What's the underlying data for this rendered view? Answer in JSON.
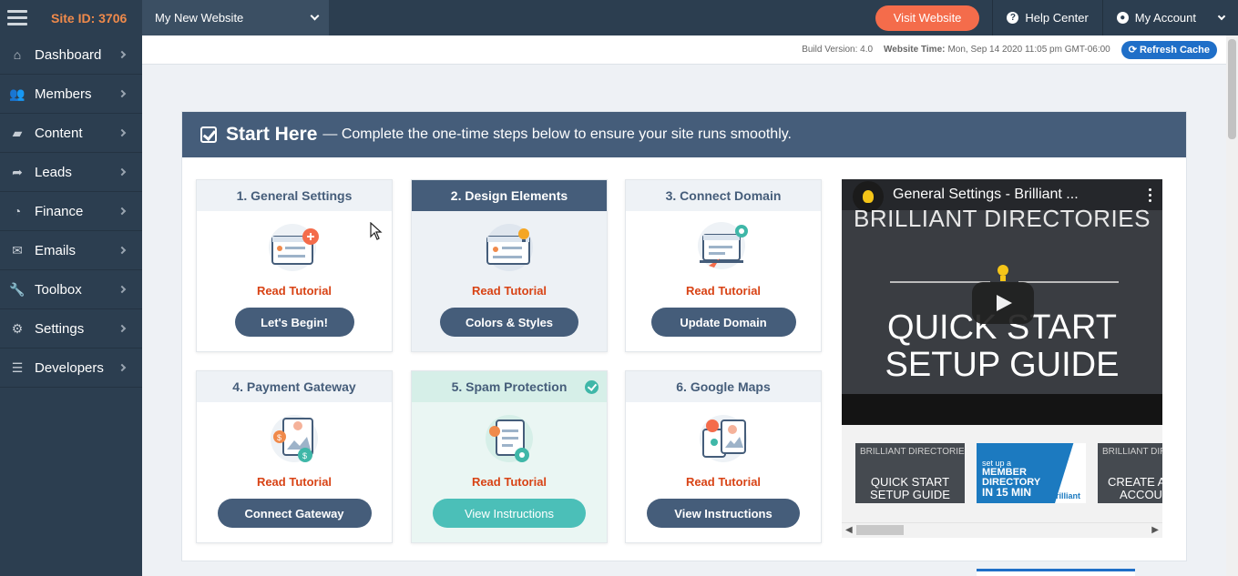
{
  "topbar": {
    "site_id": "Site ID: 3706",
    "site_select": "My New Website",
    "visit_button": "Visit Website",
    "help_center": "Help Center",
    "my_account": "My Account"
  },
  "sidebar": {
    "items": [
      {
        "label": "Dashboard",
        "icon": "home-icon",
        "glyph": "⌂"
      },
      {
        "label": "Members",
        "icon": "users-icon",
        "glyph": "👥"
      },
      {
        "label": "Content",
        "icon": "folder-icon",
        "glyph": "▰"
      },
      {
        "label": "Leads",
        "icon": "share-icon",
        "glyph": "➦"
      },
      {
        "label": "Finance",
        "icon": "pie-chart-icon",
        "glyph": "◔"
      },
      {
        "label": "Emails",
        "icon": "inbox-icon",
        "glyph": "✉"
      },
      {
        "label": "Toolbox",
        "icon": "wrench-icon",
        "glyph": "🔧"
      },
      {
        "label": "Settings",
        "icon": "gear-icon",
        "glyph": "⚙"
      },
      {
        "label": "Developers",
        "icon": "sliders-icon",
        "glyph": "☰"
      }
    ]
  },
  "subheader": {
    "build_label": "Build Version: 4.0",
    "time_key": "Website Time:",
    "time_value": "Mon, Sep 14 2020 11:05 pm GMT-06:00",
    "refresh_button": "Refresh Cache"
  },
  "start_here": {
    "title": "Start Here",
    "subtitle": "— Complete the one-time steps below to ensure your site runs smoothly."
  },
  "cards": [
    {
      "title": "1. General Settings",
      "link": "Read Tutorial",
      "button": "Let's Begin!"
    },
    {
      "title": "2. Design Elements",
      "link": "Read Tutorial",
      "button": "Colors & Styles"
    },
    {
      "title": "3. Connect Domain",
      "link": "Read Tutorial",
      "button": "Update Domain"
    },
    {
      "title": "4. Payment Gateway",
      "link": "Read Tutorial",
      "button": "Connect Gateway"
    },
    {
      "title": "5. Spam Protection",
      "link": "Read Tutorial",
      "button": "View Instructions"
    },
    {
      "title": "6. Google Maps",
      "link": "Read Tutorial",
      "button": "View Instructions"
    }
  ],
  "video": {
    "title": "General Settings - Brilliant ...",
    "brand": "BRILLIANT DIRECTORIES",
    "line1": "QUICK START",
    "line2": "SETUP GUIDE"
  },
  "thumbnails": {
    "t1_brand": "BRILLIANT DIRECTORIES",
    "t1_line1": "QUICK START",
    "t1_line2": "SETUP GUIDE",
    "t2_small": "set up a",
    "t2_line1": "MEMBER",
    "t2_line2": "DIRECTORY",
    "t2_line3": "IN 15 MIN",
    "t2_brand": "Brilliant",
    "t3_brand": "BRILLIANT DIRECTORIES",
    "t3_line1": "CREATE A",
    "t3_line2": "ACCOU"
  },
  "colors": {
    "navy": "#2c3e50",
    "slate": "#455d7a",
    "orange": "#f46c4b",
    "accent_red": "#d84315",
    "teal": "#4bbfb8",
    "blue": "#1f6fc8"
  }
}
